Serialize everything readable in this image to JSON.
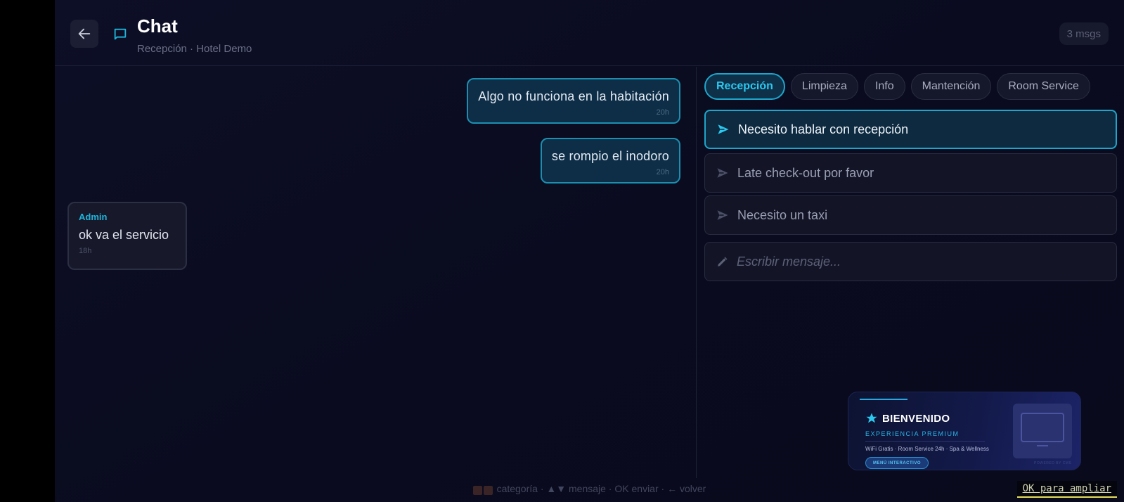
{
  "header": {
    "back_icon": "arrow-left-icon",
    "chat_icon": "chat-bubble-icon",
    "title": "Chat",
    "subtitle": "Recepción · Hotel Demo",
    "message_count": "3 msgs"
  },
  "messages": [
    {
      "direction": "outgoing",
      "text": "Algo no funciona en la habitación",
      "time": "20h"
    },
    {
      "direction": "outgoing",
      "text": "se rompio el inodoro",
      "time": "20h"
    },
    {
      "direction": "incoming",
      "sender": "Admin",
      "text": "ok va el servicio",
      "time": "18h"
    }
  ],
  "categories": {
    "tabs": [
      "Recepción",
      "Limpieza",
      "Info",
      "Mantención",
      "Room Service"
    ],
    "selected": "Recepción"
  },
  "quick_replies": [
    {
      "icon": "send-icon",
      "text": "Necesito hablar con recepción",
      "selected": true
    },
    {
      "icon": "send-icon",
      "text": "Late check-out por favor",
      "selected": false
    },
    {
      "icon": "send-icon",
      "text": "Necesito un taxi",
      "selected": false
    }
  ],
  "composer": {
    "icon": "pencil-icon",
    "placeholder": "Escribir mensaje...",
    "value": ""
  },
  "promo": {
    "icon": "star-icon",
    "title": "BIENVENIDO",
    "subtitle": "EXPERIENCIA PREMIUM",
    "features": "WiFi Gratis · Room Service 24h · Spa & Wellness",
    "button": "MENÚ INTERACTIVO",
    "screen_icon": "tv-icon",
    "powered": "POWERED BY CMS"
  },
  "footer": {
    "hint_category": "categoría",
    "hint_message": "▲▼ mensaje",
    "hint_send": "OK enviar",
    "hint_back": "← volver",
    "zoom_hint": "OK para ampliar"
  },
  "colors": {
    "accent": "#1ea5cb",
    "background": "#0a0b1f",
    "bubble_out": "#0e2d47",
    "bubble_in": "#17192b"
  }
}
